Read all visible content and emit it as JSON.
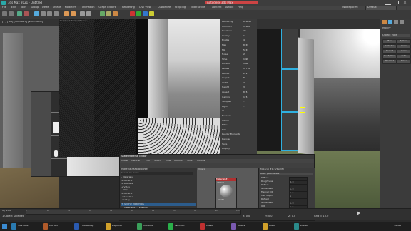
{
  "window": {
    "title": "3ds Max 2021 - Untitled",
    "right_label": "Autodesk 3ds Max"
  },
  "menubar": {
    "items": [
      "File",
      "Edit",
      "Tools",
      "Group",
      "Views",
      "Create",
      "Modifiers",
      "Animation",
      "Graph Editors",
      "Rendering",
      "Civil View",
      "Customize",
      "Scripting",
      "Interactive",
      "Content",
      "Arnold",
      "Help"
    ],
    "right_items": [
      "Workspaces:",
      "Default"
    ]
  },
  "left_viewport": {
    "label": "[+] [Top] [Standard] [Wireframe]"
  },
  "render_window": {
    "label": "Rendered Frame Window"
  },
  "properties": {
    "rows": [
      "Rendering",
      "Common",
      "Renderer",
      "Quality",
      "Enable",
      "Max",
      "Min",
      "Noise",
      "Time",
      "Buckets",
      "Passes",
      "Render",
      "Output",
      "Width",
      "Height",
      "Aspect",
      "Gamma",
      "Samples",
      "Lights",
      "GI",
      "Bounces",
      "Clamp",
      "Filter",
      "Size",
      "Render Elements",
      "Denoise",
      "Save",
      "Display"
    ],
    "values": [
      "0.0025",
      "1.000",
      "24",
      "1",
      "4",
      "0.01",
      "5.0",
      "2",
      "1920",
      "1080",
      "1.778",
      "2.2",
      "8",
      "4",
      "3",
      "0.5",
      "1.5",
      "-",
      "-",
      "-"
    ]
  },
  "right_panel": {
    "title": "Modify",
    "buttons": [
      "Box",
      "Sphere",
      "Cylinder",
      "Torus",
      "Teapot",
      "Cone",
      "GeoSphere",
      "Tube",
      "Pyramid",
      "Plane"
    ],
    "section": "Object Type"
  },
  "material_editor": {
    "title": "Slate Material Editor",
    "menu": [
      "Modes",
      "Material",
      "Edit",
      "Select",
      "View",
      "Options",
      "Tools",
      "Utilities"
    ],
    "browser_header": "Material/Map Browser",
    "browser_search": "Search by Name ...",
    "browser_rows": [
      "- Materials",
      "+ General",
      "+ Scanline",
      "+ V-Ray",
      "- Maps",
      "+ General",
      "+ Scanline",
      "+ V-Ray"
    ],
    "browser_selected": "+ Scene Materials",
    "scene_rows": [
      "Material #1 : VRayMtl",
      "Material #2 : VRayMtl",
      "Material #3 : VRayMtl",
      "Material #4 : VRayMtl",
      "Material #5 : VRayMtl"
    ],
    "view_label": "View1",
    "node_title": "Material #1",
    "node_type": "VRayMtl",
    "slots": [
      "Diffuse",
      "Reflect",
      "Gloss",
      "Refract",
      "IOR",
      "Bump",
      "Disp"
    ],
    "param_header": "Material #1 ( VRayMtl )",
    "param_section": "Basic parameters",
    "param_rows": [
      {
        "label": "Diffuse",
        "value": ""
      },
      {
        "label": "Roughness",
        "value": "0.0"
      },
      {
        "label": "Reflect",
        "value": ""
      },
      {
        "label": "Glossiness",
        "value": "1.0"
      },
      {
        "label": "Fresnel IOR",
        "value": "1.6"
      },
      {
        "label": "Max depth",
        "value": "5"
      },
      {
        "label": "Refract",
        "value": ""
      },
      {
        "label": "Glossiness",
        "value": "1.0"
      },
      {
        "label": "IOR",
        "value": "1.6"
      },
      {
        "label": "Abbe number",
        "value": "50.0"
      },
      {
        "label": "Fog color",
        "value": ""
      },
      {
        "label": "Translucency",
        "value": "None"
      }
    ]
  },
  "timeline": {
    "frame": "0 / 100",
    "ticks": [
      "0",
      "10",
      "20",
      "30",
      "40",
      "50",
      "60",
      "70",
      "80",
      "90",
      "100"
    ],
    "status": "1 Object Selected",
    "coords": [
      "X: 0.0",
      "Y: 0.0",
      "Z: 0.0"
    ],
    "grid": "Grid = 10.0"
  },
  "taskbar": {
    "buttons": [
      "3ds Max",
      "Render",
      "Photoshop",
      "Explorer",
      "Chrome",
      "WeChat",
      "Music",
      "Notes",
      "Files",
      "Editor"
    ],
    "clock": "10:40"
  }
}
